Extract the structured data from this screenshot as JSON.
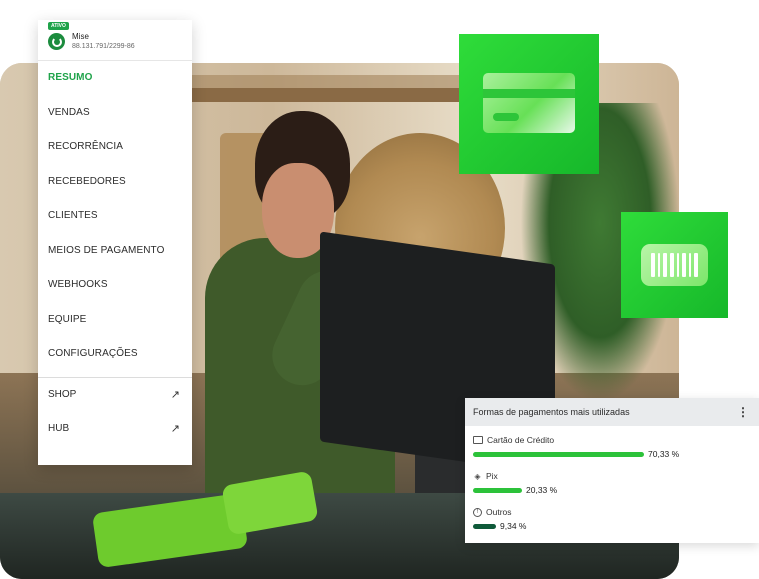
{
  "menu": {
    "account": {
      "badge": "ATIVO",
      "name": "Mise",
      "id": "88.131.791/2299-86",
      "logo_icon": "store-logo-icon"
    },
    "items": [
      {
        "label": "RESUMO",
        "active": true
      },
      {
        "label": "VENDAS",
        "active": false
      },
      {
        "label": "RECORRÊNCIA",
        "active": false
      },
      {
        "label": "RECEBEDORES",
        "active": false
      },
      {
        "label": "CLIENTES",
        "active": false
      },
      {
        "label": "MEIOS DE PAGAMENTO",
        "active": false
      },
      {
        "label": "WEBHOOKS",
        "active": false
      },
      {
        "label": "EQUIPE",
        "active": false
      },
      {
        "label": "CONFIGURAÇÕES",
        "active": false
      }
    ],
    "external": [
      {
        "label": "SHOP",
        "icon": "↗"
      },
      {
        "label": "HUB",
        "icon": "↗"
      }
    ],
    "active_color": "#1fa34a"
  },
  "tiles": {
    "card_icon": "credit-card-icon",
    "barcode_icon": "barcode-icon",
    "color": "#1fc72f"
  },
  "payment_methods": {
    "title": "Formas de pagamentos mais utilizadas",
    "menu_icon": "⋮",
    "rows": [
      {
        "label": "Cartão de Crédito",
        "icon": "credit-card-icon",
        "value": "70,33 %",
        "fraction": 0.7033,
        "color": "#2cc23a"
      },
      {
        "label": "Pix",
        "icon": "pix-icon",
        "value": "20,33 %",
        "fraction": 0.2033,
        "color": "#2cc23a"
      },
      {
        "label": "Outros",
        "icon": "info-icon",
        "value": "9,34 %",
        "fraction": 0.0934,
        "color": "#0f5a3a"
      }
    ]
  }
}
